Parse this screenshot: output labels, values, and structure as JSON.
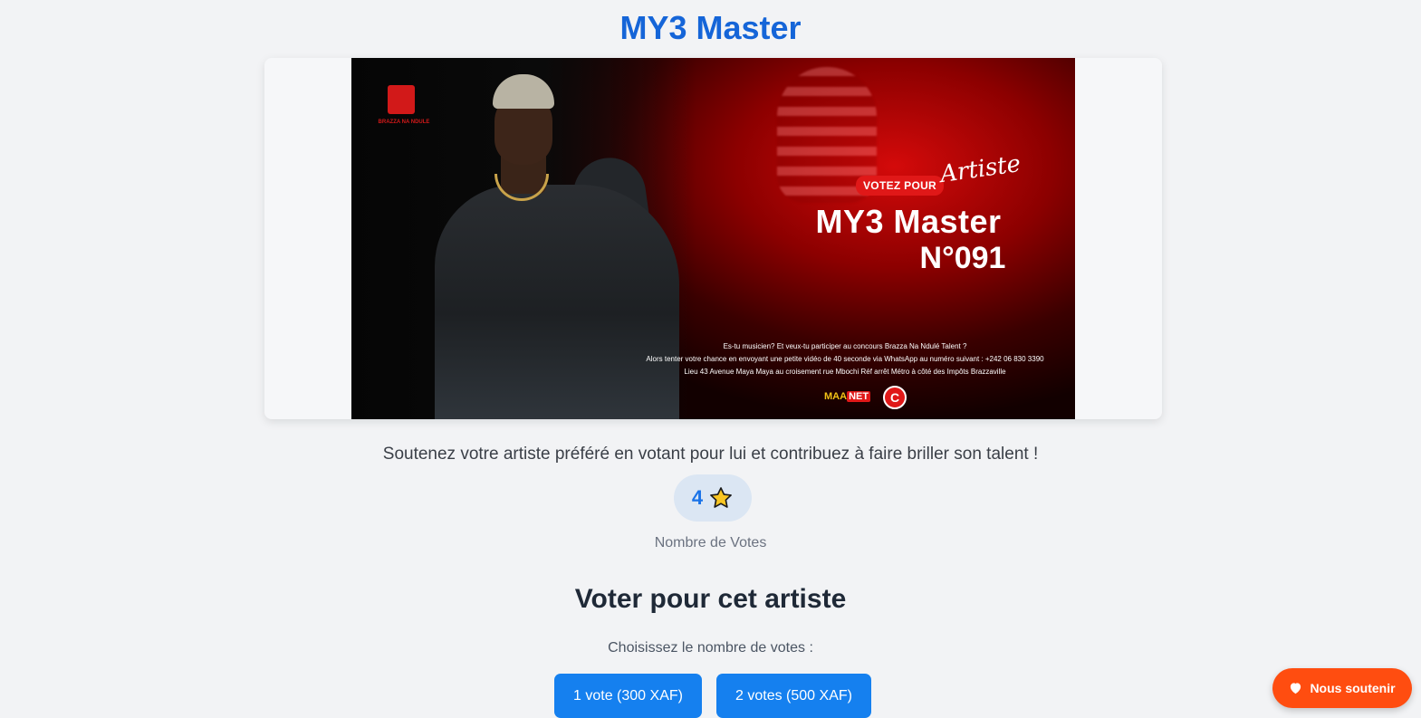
{
  "page": {
    "title": "MY3 Master",
    "subtitle": "Soutenez votre artiste préféré en votant pour lui et contribuez à faire briller son talent !",
    "vote_count": "4",
    "vote_count_label": "Nombre de Votes",
    "section_title": "Voter pour cet artiste",
    "choose_label": "Choisissez le nombre de votes :"
  },
  "banner": {
    "vote_pill": "VOTEZ POUR",
    "script_word": "Artiste",
    "name": "MY3 Master",
    "number": "N°091",
    "info_lines": [
      "Es-tu musicien? Et veux-tu participer au concours Brazza Na Ndulé Talent ?",
      "Alors tenter votre chance en envoyant une petite vidéo de 40 seconde via WhatsApp au numéro suivant : +242 06 830 3390",
      "Lieu 43 Avenue Maya Maya au croisement rue Mbochi Réf arrêt Métro à côté des Impôts Brazzaville"
    ],
    "logo_text": "BRAZZA NA NDULE",
    "brand_mynet_a": "MAA",
    "brand_mynet_b": "NET",
    "brand_circle": "C"
  },
  "vote_options": [
    {
      "label": "1 vote (300 XAF)"
    },
    {
      "label": "2 votes (500 XAF)"
    }
  ],
  "support_button": {
    "label": "Nous soutenir",
    "icon": "heart-icon"
  },
  "colors": {
    "title": "#1565d8",
    "vote_button": "#1580ef",
    "support_button": "#ff4d10",
    "background": "#f2f3f5"
  }
}
